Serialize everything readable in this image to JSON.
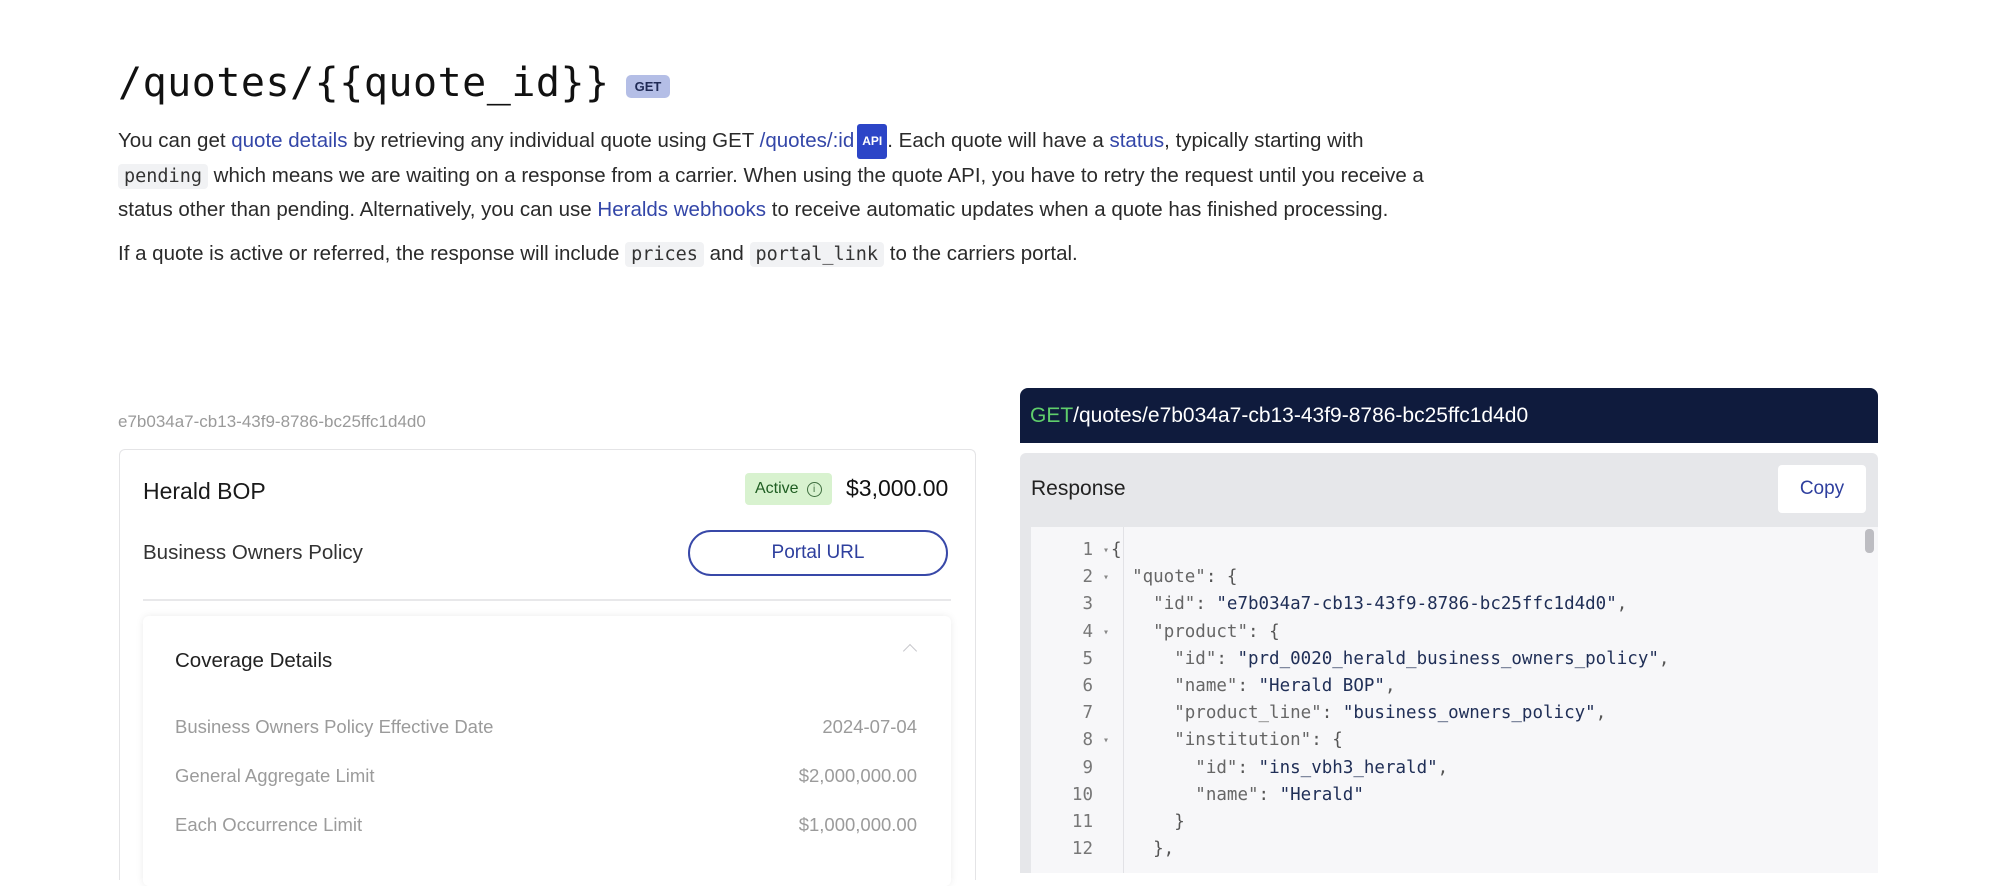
{
  "heading": {
    "title": "/quotes/{{quote_id}}",
    "method_badge": "GET"
  },
  "intro": {
    "p1_a": "You can get ",
    "p1_link1": "quote details",
    "p1_b": " by retrieving any individual quote using GET ",
    "p1_link2": "/quotes/:id",
    "p1_api_badge": "API",
    "p1_c": ". Each quote will have a ",
    "p1_link3": "status",
    "p1_d": ", typically starting with ",
    "p1_code1": "pending",
    "p1_e": " which means we are waiting on a response from a carrier. When using the quote API, you have to retry the request until you receive a status other than pending. Alternatively, you can use ",
    "p1_link4": "Heralds webhooks",
    "p1_f": " to receive automatic updates when a quote has finished processing.",
    "p2_a": "If a quote is active or referred, the response will include ",
    "p2_code1": "prices",
    "p2_b": " and ",
    "p2_code2": "portal_link",
    "p2_c": " to the carriers portal."
  },
  "quote_card": {
    "quote_id": "e7b034a7-cb13-43f9-8786-bc25ffc1d4d0",
    "product_name": "Herald BOP",
    "product_line": "Business Owners Policy",
    "status": "Active",
    "price": "$3,000.00",
    "portal_button": "Portal URL",
    "coverage_title": "Coverage Details",
    "coverage_rows": [
      {
        "label": "Business Owners Policy Effective Date",
        "value": "2024-07-04"
      },
      {
        "label": "General Aggregate Limit",
        "value": "$2,000,000.00"
      },
      {
        "label": "Each Occurrence Limit",
        "value": "$1,000,000.00"
      }
    ]
  },
  "request": {
    "method": "GET",
    "path": "/quotes/e7b034a7-cb13-43f9-8786-bc25ffc1d4d0"
  },
  "response": {
    "title": "Response",
    "copy_label": "Copy",
    "lines": [
      {
        "n": "1",
        "fold": true
      },
      {
        "n": "2",
        "fold": true
      },
      {
        "n": "3",
        "fold": false
      },
      {
        "n": "4",
        "fold": true
      },
      {
        "n": "5",
        "fold": false
      },
      {
        "n": "6",
        "fold": false
      },
      {
        "n": "7",
        "fold": false
      },
      {
        "n": "8",
        "fold": true
      },
      {
        "n": "9",
        "fold": false
      },
      {
        "n": "10",
        "fold": false
      },
      {
        "n": "11",
        "fold": false
      },
      {
        "n": "12",
        "fold": false
      }
    ],
    "code": [
      "{",
      "  \"quote\": {",
      "    \"id\": \"e7b034a7-cb13-43f9-8786-bc25ffc1d4d0\",",
      "    \"product\": {",
      "      \"id\": \"prd_0020_herald_business_owners_policy\",",
      "      \"name\": \"Herald BOP\",",
      "      \"product_line\": \"business_owners_policy\",",
      "      \"institution\": {",
      "        \"id\": \"ins_vbh3_herald\",",
      "        \"name\": \"Herald\"",
      "      }",
      "    },"
    ]
  }
}
